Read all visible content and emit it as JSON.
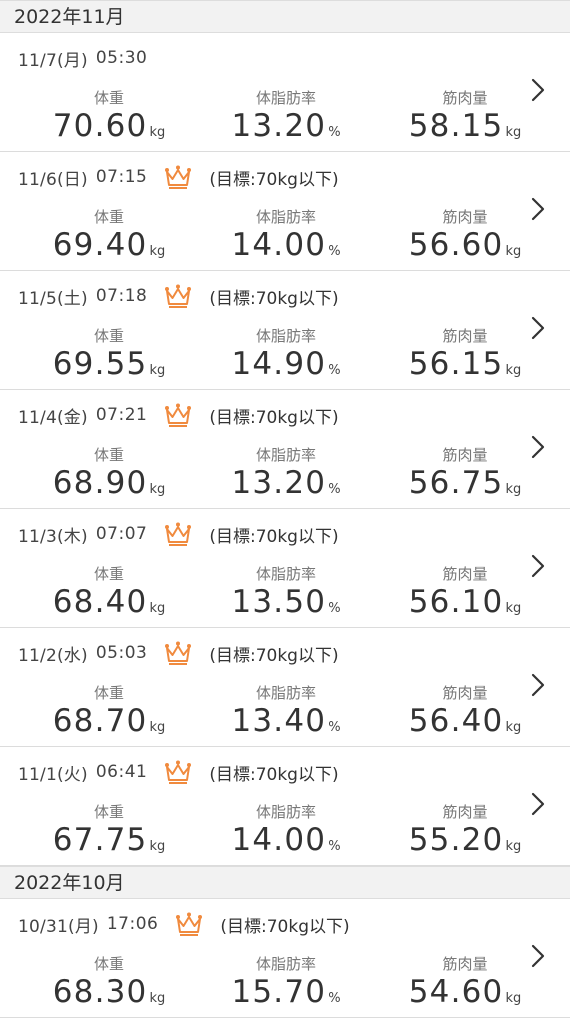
{
  "colors": {
    "crown": "#f08a3e",
    "accent_text": "#333333"
  },
  "groups": [
    {
      "month": "2022年11月",
      "entries": [
        {
          "date": "11/7(月)",
          "time": "05:30",
          "crown": false,
          "goal": "",
          "weight_label": "体重",
          "weight": "70.60",
          "weight_unit": "kg",
          "fat_label": "体脂肪率",
          "fat": "13.20",
          "fat_unit": "%",
          "muscle_label": "筋肉量",
          "muscle": "58.15",
          "muscle_unit": "kg"
        },
        {
          "date": "11/6(日)",
          "time": "07:15",
          "crown": true,
          "crown_icon": "crown-icon",
          "goal": "(目標:70kg以下)",
          "weight_label": "体重",
          "weight": "69.40",
          "weight_unit": "kg",
          "fat_label": "体脂肪率",
          "fat": "14.00",
          "fat_unit": "%",
          "muscle_label": "筋肉量",
          "muscle": "56.60",
          "muscle_unit": "kg"
        },
        {
          "date": "11/5(土)",
          "time": "07:18",
          "crown": true,
          "crown_icon": "crown-icon",
          "goal": "(目標:70kg以下)",
          "weight_label": "体重",
          "weight": "69.55",
          "weight_unit": "kg",
          "fat_label": "体脂肪率",
          "fat": "14.90",
          "fat_unit": "%",
          "muscle_label": "筋肉量",
          "muscle": "56.15",
          "muscle_unit": "kg"
        },
        {
          "date": "11/4(金)",
          "time": "07:21",
          "crown": true,
          "crown_icon": "crown-icon",
          "goal": "(目標:70kg以下)",
          "weight_label": "体重",
          "weight": "68.90",
          "weight_unit": "kg",
          "fat_label": "体脂肪率",
          "fat": "13.20",
          "fat_unit": "%",
          "muscle_label": "筋肉量",
          "muscle": "56.75",
          "muscle_unit": "kg"
        },
        {
          "date": "11/3(木)",
          "time": "07:07",
          "crown": true,
          "crown_icon": "crown-icon",
          "goal": "(目標:70kg以下)",
          "weight_label": "体重",
          "weight": "68.40",
          "weight_unit": "kg",
          "fat_label": "体脂肪率",
          "fat": "13.50",
          "fat_unit": "%",
          "muscle_label": "筋肉量",
          "muscle": "56.10",
          "muscle_unit": "kg"
        },
        {
          "date": "11/2(水)",
          "time": "05:03",
          "crown": true,
          "crown_icon": "crown-icon",
          "goal": "(目標:70kg以下)",
          "weight_label": "体重",
          "weight": "68.70",
          "weight_unit": "kg",
          "fat_label": "体脂肪率",
          "fat": "13.40",
          "fat_unit": "%",
          "muscle_label": "筋肉量",
          "muscle": "56.40",
          "muscle_unit": "kg"
        },
        {
          "date": "11/1(火)",
          "time": "06:41",
          "crown": true,
          "crown_icon": "crown-icon",
          "goal": "(目標:70kg以下)",
          "weight_label": "体重",
          "weight": "67.75",
          "weight_unit": "kg",
          "fat_label": "体脂肪率",
          "fat": "14.00",
          "fat_unit": "%",
          "muscle_label": "筋肉量",
          "muscle": "55.20",
          "muscle_unit": "kg"
        }
      ]
    },
    {
      "month": "2022年10月",
      "entries": [
        {
          "date": "10/31(月)",
          "time": "17:06",
          "crown": true,
          "crown_icon": "crown-icon",
          "goal": "(目標:70kg以下)",
          "weight_label": "体重",
          "weight": "68.30",
          "weight_unit": "kg",
          "fat_label": "体脂肪率",
          "fat": "15.70",
          "fat_unit": "%",
          "muscle_label": "筋肉量",
          "muscle": "54.60",
          "muscle_unit": "kg"
        }
      ]
    }
  ]
}
